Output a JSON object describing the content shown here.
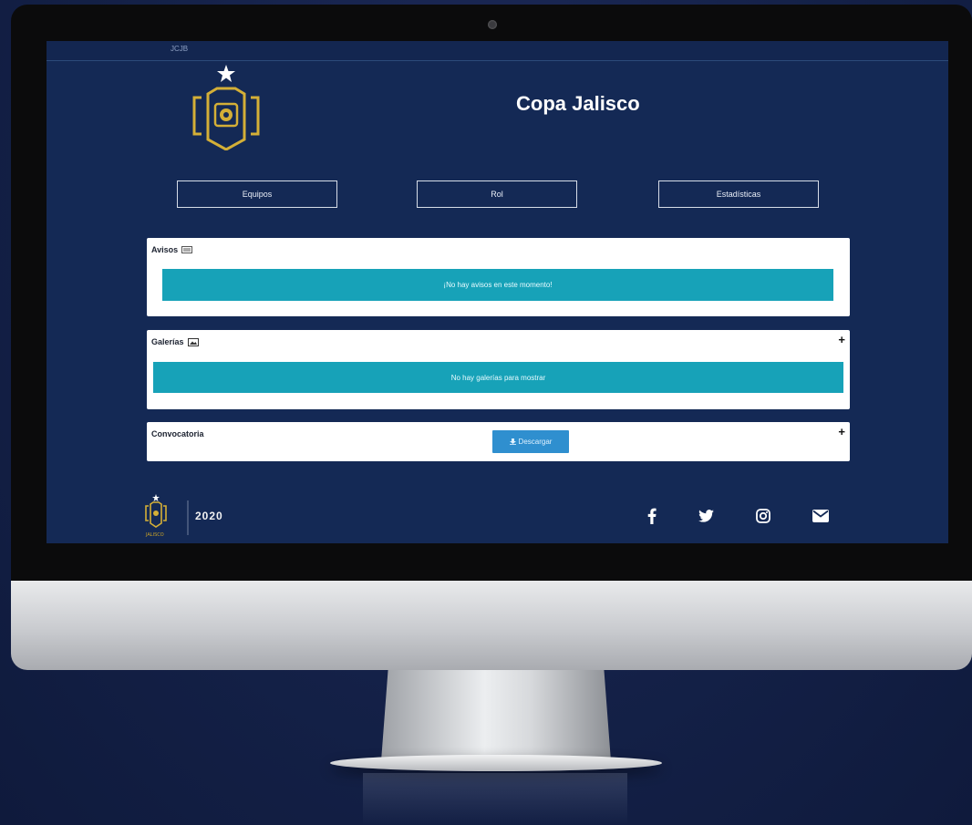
{
  "app": {
    "title": "Copa Jalisco",
    "topbar_label": "JCJB"
  },
  "nav": {
    "buttons": [
      {
        "label": "Equipos"
      },
      {
        "label": "Rol"
      },
      {
        "label": "Estadísticas"
      }
    ]
  },
  "avisos": {
    "title": "Avisos",
    "icon": "newspaper-icon",
    "message": "¡No hay avisos en este momento!"
  },
  "galerias": {
    "title": "Galerías",
    "icon": "image-icon",
    "message": "No hay galerías para mostrar"
  },
  "convocatoria": {
    "title": "Convocatoria",
    "download_label": "Descargar",
    "icon": "download-icon"
  },
  "footer": {
    "year": "2020",
    "brand": "JALISCO",
    "social": [
      "facebook-icon",
      "twitter-icon",
      "instagram-icon",
      "mail-icon"
    ]
  },
  "colors": {
    "screen_bg": "#142955",
    "accent": "#17a2b8",
    "gold": "#c9a227",
    "button_blue": "#2f8fcf"
  }
}
